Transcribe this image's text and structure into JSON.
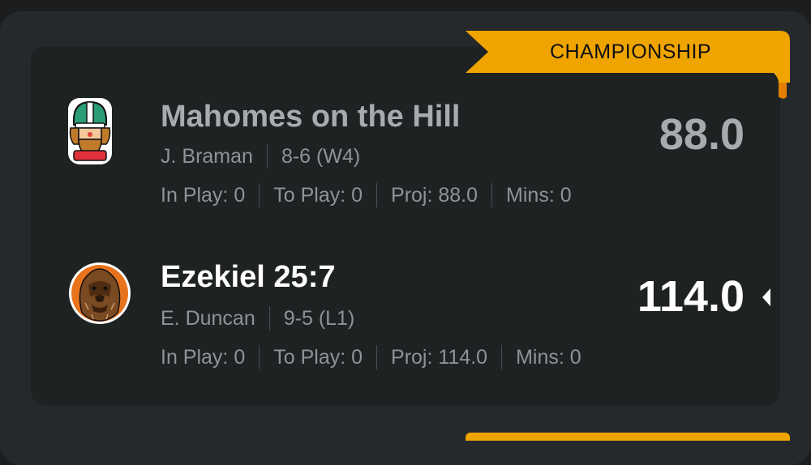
{
  "banner": {
    "label": "CHAMPIONSHIP",
    "color": "#f0a400"
  },
  "teams": [
    {
      "name": "Mahomes on the Hill",
      "owner": "J. Braman",
      "record": "8-6 (W4)",
      "in_play": "In Play: 0",
      "to_play": "To Play: 0",
      "proj": "Proj: 88.0",
      "mins": "Mins: 0",
      "score": "88.0",
      "avatar_icon": "football-helmet-icon",
      "winning": false
    },
    {
      "name": "Ezekiel 25:7",
      "owner": "E. Duncan",
      "record": "9-5 (L1)",
      "in_play": "In Play: 0",
      "to_play": "To Play: 0",
      "proj": "Proj: 114.0",
      "mins": "Mins: 0",
      "score": "114.0",
      "avatar_icon": "wookiee-icon",
      "winning": true
    }
  ]
}
